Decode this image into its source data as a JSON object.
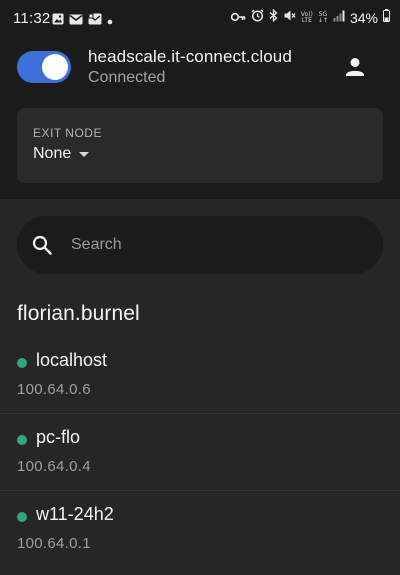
{
  "status_bar": {
    "time": "11:32",
    "volte_line1": "Vo))",
    "volte_line2": "LTE",
    "net_line1": "5G",
    "net_line2": "↓↑",
    "battery": "34%",
    "left_icons": [
      "image-icon",
      "gmail-icon",
      "mail-app-icon",
      "dot-icon"
    ],
    "right_icons": [
      "vpn-key-icon",
      "alarm-icon",
      "bluetooth-icon",
      "mute-icon",
      "signal-icon",
      "battery-icon"
    ]
  },
  "header": {
    "server": "headscale.it-connect.cloud",
    "status": "Connected",
    "toggle_on": true,
    "account_icon": "account-icon"
  },
  "exit_node": {
    "label": "EXIT NODE",
    "value": "None",
    "dropdown_icon": "dropdown-arrow-icon"
  },
  "search": {
    "placeholder": "Search",
    "value": "",
    "icon": "search-icon"
  },
  "section": {
    "title": "florian.burnel"
  },
  "devices": [
    {
      "name": "localhost",
      "ip": "100.64.0.6",
      "online": true
    },
    {
      "name": "pc-flo",
      "ip": "100.64.0.4",
      "online": true
    },
    {
      "name": "w11-24h2",
      "ip": "100.64.0.1",
      "online": true
    }
  ],
  "colors": {
    "accent": "#3f6fd8",
    "online": "#2ea77b",
    "background": "#262626",
    "header_background": "#1b1b1b",
    "card_background": "#2a2a2a"
  }
}
